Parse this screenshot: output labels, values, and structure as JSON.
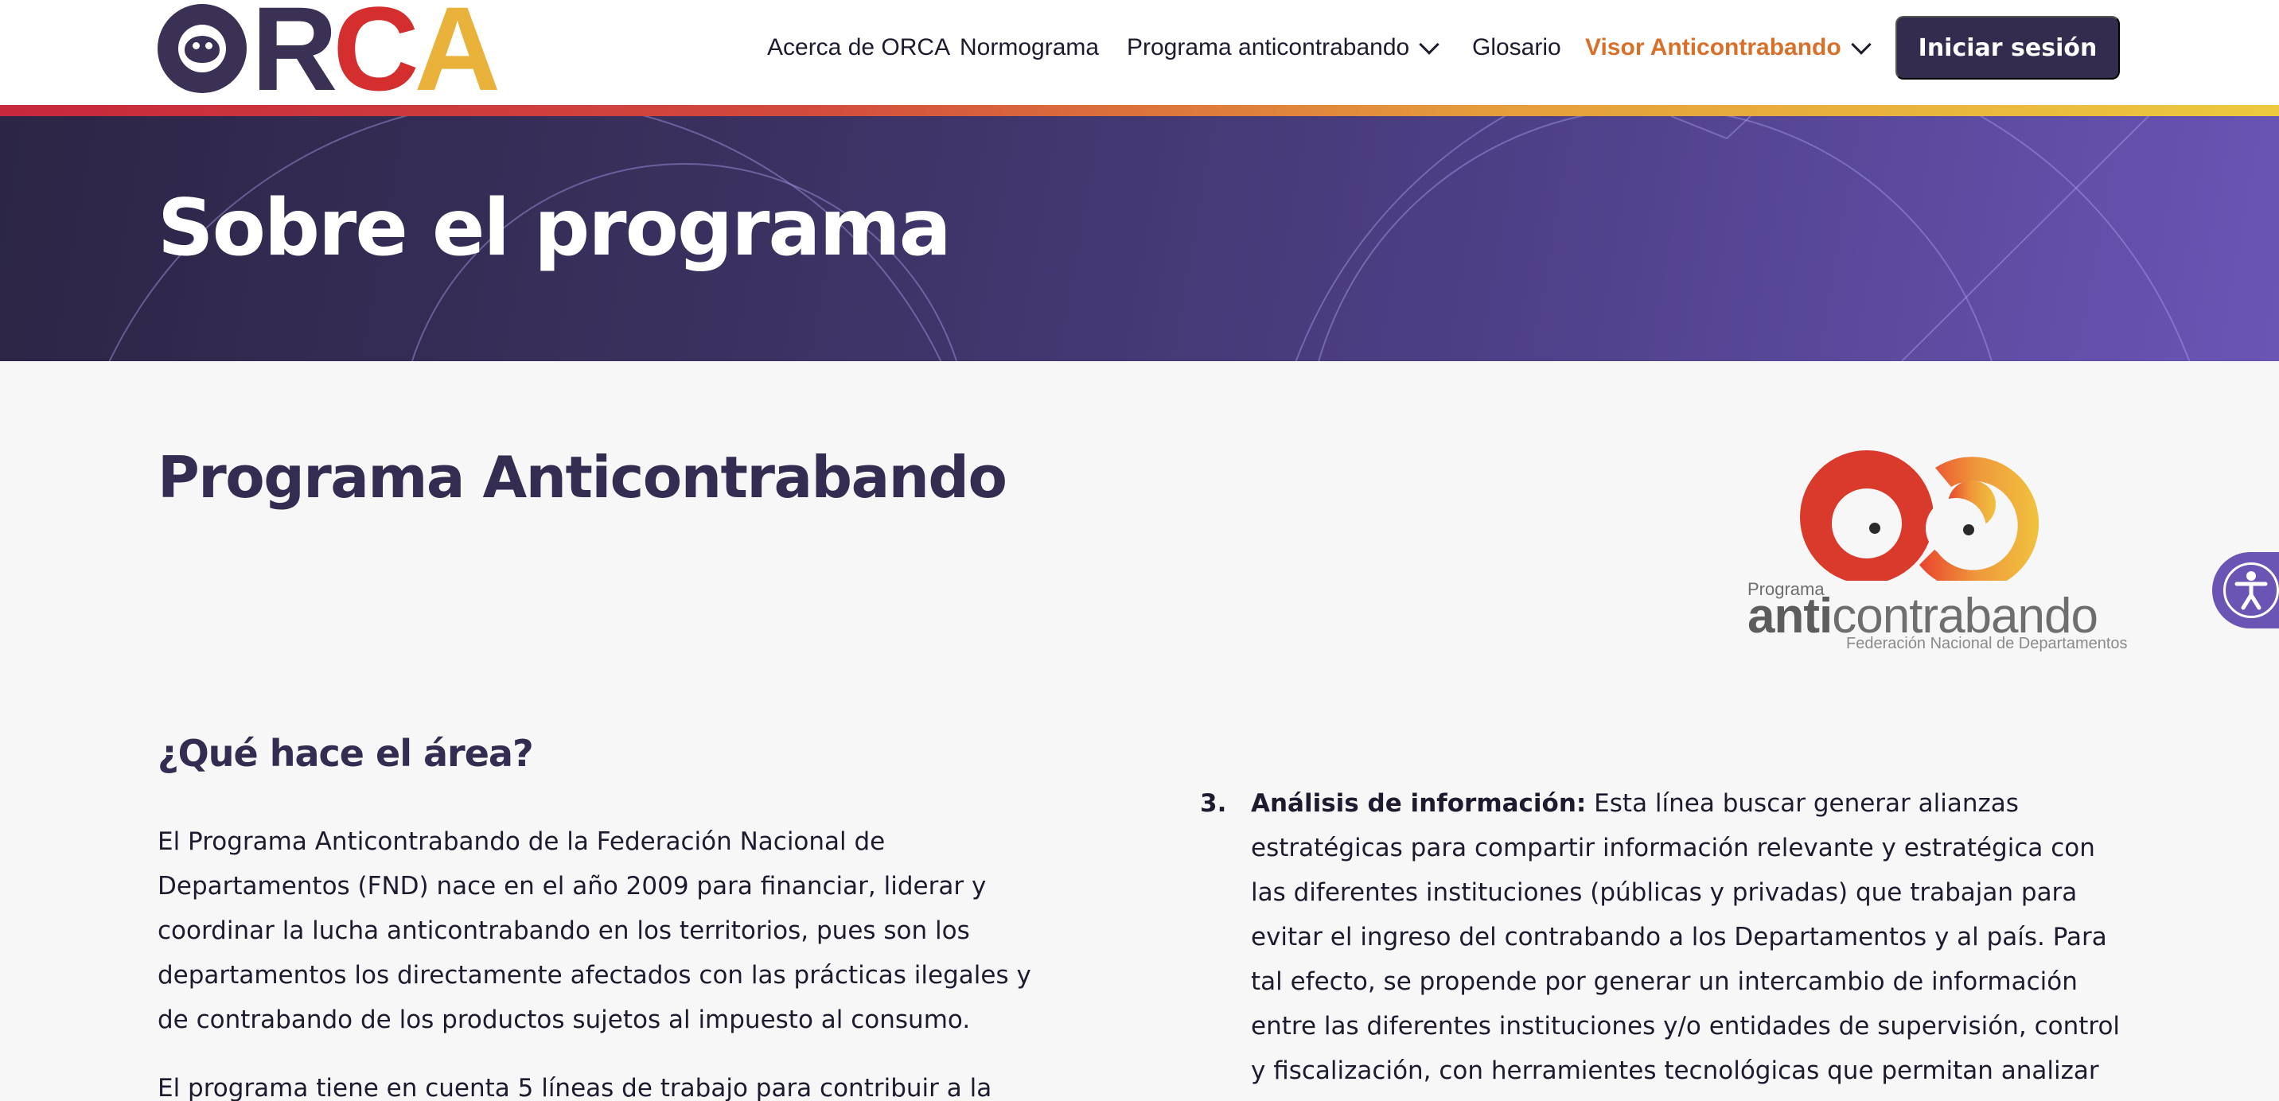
{
  "header": {
    "logo": {
      "letters": [
        "R",
        "C",
        "A"
      ]
    },
    "nav": [
      {
        "label": "Acerca de ORCA"
      },
      {
        "label": "Normograma"
      },
      {
        "label": "Programa anticontrabando"
      },
      {
        "label": "Glosario"
      },
      {
        "label": "Visor Anticontrabando"
      }
    ],
    "login_label": "Iniciar sesión"
  },
  "banner": {
    "title": "Sobre el programa"
  },
  "main": {
    "program_heading": "Programa Anticontrabando",
    "program_logo": {
      "small_label": "Programa",
      "word_bold": "anti",
      "word_light": "contrabando",
      "subtitle": "Federación Nacional de Departamentos"
    },
    "area_heading": "¿Qué hace el área?",
    "paragraph_1": "El Programa Anticontrabando de la Federación Nacional de Departamentos (FND) nace en el año 2009 para financiar, liderar y coordinar la lucha anticontrabando en los territorios, pues son los departamentos los directamente afectados con las prácticas ilegales y de contrabando de los productos sujetos al impuesto al consumo.",
    "paragraph_2": "El programa tiene en cuenta 5 líneas de trabajo para contribuir a la",
    "list_item": {
      "number": "3.",
      "title": "Análisis de información:",
      "text": " Esta línea buscar generar alianzas estratégicas para compartir información relevante y estratégica con las diferentes instituciones (públicas y privadas) que trabajan para evitar el ingreso del contrabando a los Departamentos y al país. Para tal efecto, se propende por generar un intercambio de información entre las diferentes instituciones y/o entidades de supervisión, control y fiscalización, con herramientes tecnológicas que permitan analizar cada una de las"
    }
  },
  "colors": {
    "brand_purple": "#342c4e",
    "brand_red": "#d42e2e",
    "brand_yellow": "#e9b23a",
    "nav_highlight": "#d9702a",
    "banner_purple": "#4d3f86"
  },
  "icons": [
    "chevron-down-icon",
    "accessibility-icon"
  ]
}
